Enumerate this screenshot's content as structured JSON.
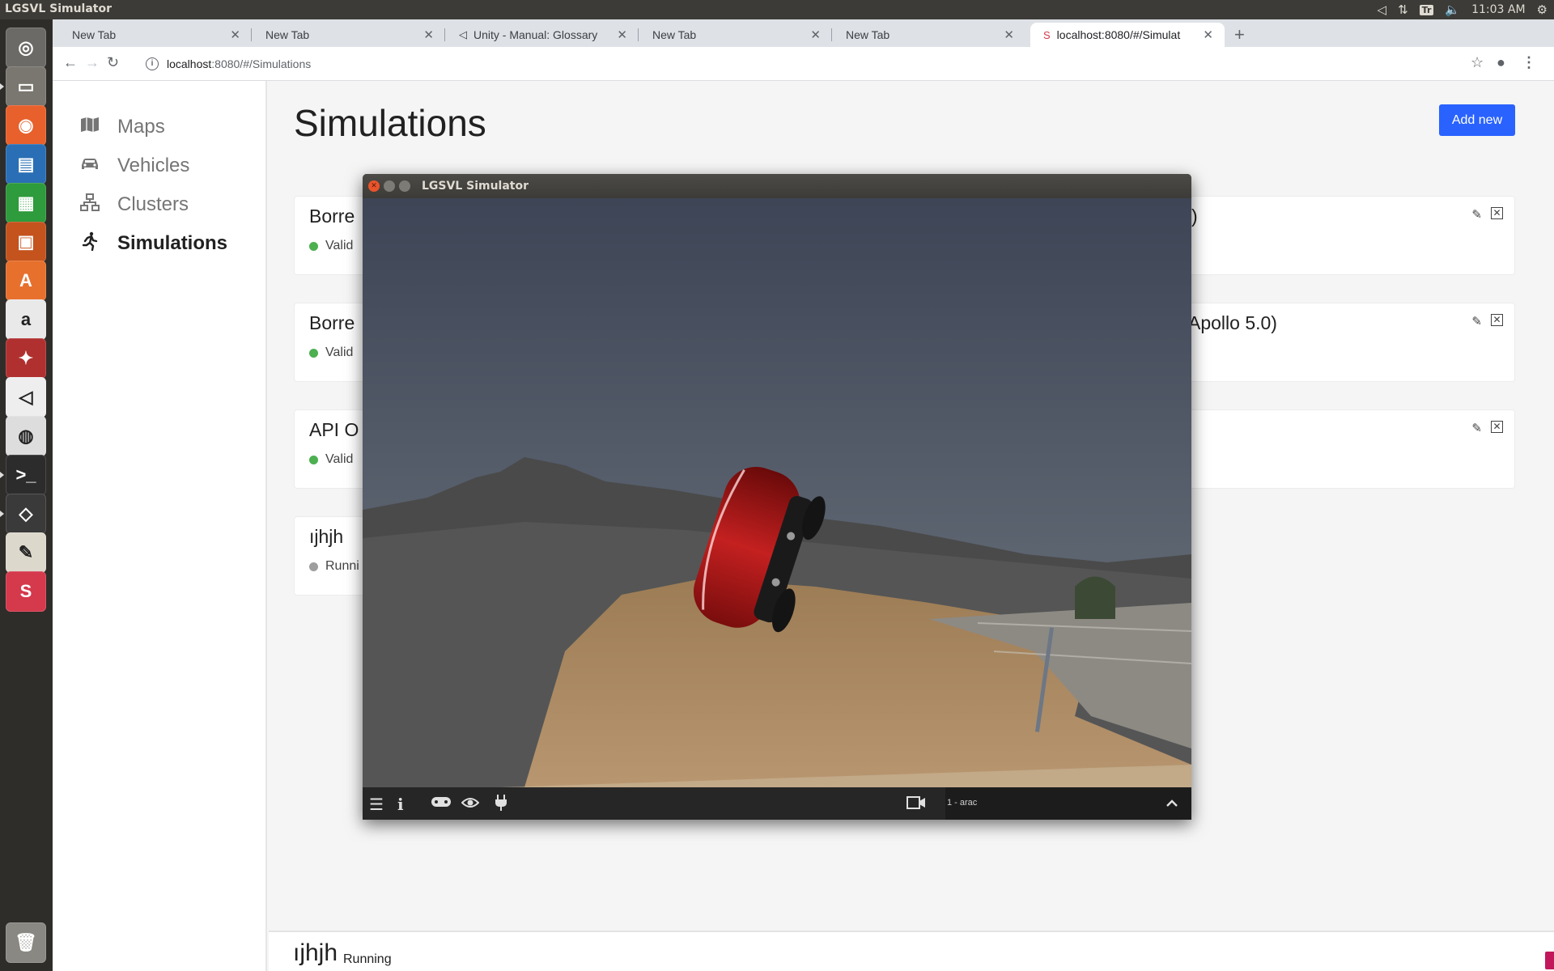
{
  "top_panel": {
    "app_title": "LGSVL Simulator",
    "time": "11:03 AM",
    "keyboard": "Tr"
  },
  "launcher": {
    "items": [
      {
        "name": "dash",
        "color": "#6b6a66"
      },
      {
        "name": "files",
        "color": "#7a7670"
      },
      {
        "name": "firefox",
        "color": "#e8602c"
      },
      {
        "name": "writer",
        "color": "#2a6fb5"
      },
      {
        "name": "calc",
        "color": "#2e9b3c"
      },
      {
        "name": "impress",
        "color": "#c4531e"
      },
      {
        "name": "software-center",
        "color": "#e7702d"
      },
      {
        "name": "amazon",
        "color": "#e9e9e9"
      },
      {
        "name": "system-settings",
        "color": "#b03030"
      },
      {
        "name": "unity-hub",
        "color": "#eeeeee"
      },
      {
        "name": "chrome",
        "color": "#dddddd"
      },
      {
        "name": "terminal",
        "color": "#2c2c2c"
      },
      {
        "name": "unity",
        "color": "#3a3a3a"
      },
      {
        "name": "text-editor",
        "color": "#ddd8cc"
      },
      {
        "name": "lgsvl",
        "color": "#d4394c"
      }
    ]
  },
  "browser": {
    "tabs": [
      {
        "title": "New Tab"
      },
      {
        "title": "New Tab"
      },
      {
        "title": "Unity - Manual: Glossary"
      },
      {
        "title": "New Tab"
      },
      {
        "title": "New Tab"
      },
      {
        "title": "localhost:8080/#/Simulat"
      }
    ],
    "url_host": "localhost",
    "url_rest": ":8080/#/Simulations"
  },
  "sidebar": {
    "items": [
      {
        "label": "Maps",
        "icon": "map-icon"
      },
      {
        "label": "Vehicles",
        "icon": "car-icon"
      },
      {
        "label": "Clusters",
        "icon": "cluster-icon"
      },
      {
        "label": "Simulations",
        "icon": "run-icon",
        "active": true
      }
    ]
  },
  "main": {
    "title": "Simulations",
    "add_button": "Add new",
    "simulations": [
      {
        "name": "Borre",
        "status": "Valid",
        "status_color": "#4caf50",
        "tail": ")"
      },
      {
        "name": "Borre",
        "status": "Valid",
        "status_color": "#4caf50",
        "tail": "Apollo 5.0)"
      },
      {
        "name": "API O",
        "status": "Valid",
        "status_color": "#4caf50",
        "tail": ""
      },
      {
        "name": "ıjhjh",
        "status": "Runni",
        "status_color": "#9e9e9e",
        "tail": ""
      }
    ]
  },
  "bottom_bar": {
    "name": "ıjhjh",
    "status": "Running",
    "stop_color": "#c2185b"
  },
  "simulator_window": {
    "title": "LGSVL Simulator",
    "camera_label": "1 - arac",
    "sky_color": "#4f5866",
    "ground_color": "#a8865c",
    "car_color": "#b01818"
  }
}
